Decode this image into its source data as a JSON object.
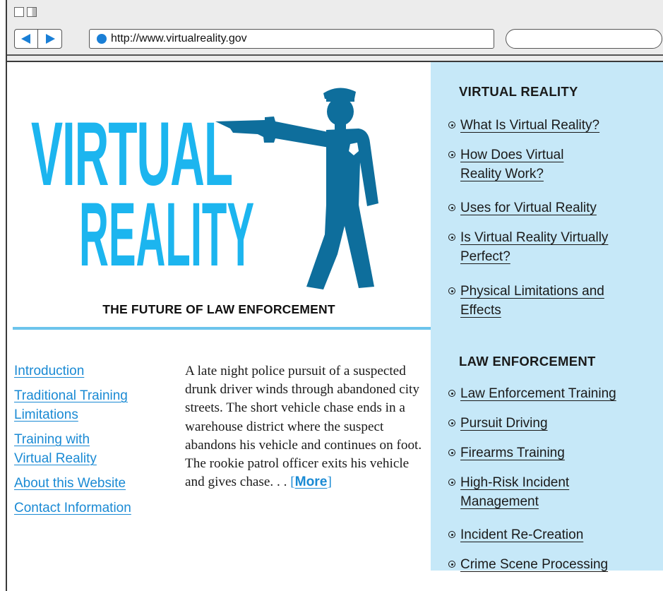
{
  "browser": {
    "url": "http://www.virtualreality.gov",
    "search_placeholder": ""
  },
  "hero": {
    "logo_line1": "VIRTUAL",
    "logo_line2": "REALITY",
    "tagline": "THE FUTURE OF LAW ENFORCEMENT"
  },
  "left_nav": [
    "Introduction",
    "Traditional Training Limitations",
    "Training with Virtual Reality",
    "About this Website",
    "Contact Information"
  ],
  "story": {
    "text": "A late night police pursuit of a suspected drunk driver winds through abandoned city streets. The short vehicle chase ends in a warehouse district where the suspect abandons his vehicle and continues on foot. The rookie patrol officer exits his vehicle and gives chase. . .",
    "more_label": "More",
    "bracket_open": "[",
    "bracket_close": "]"
  },
  "sidebar": {
    "vr_heading": "VIRTUAL REALITY",
    "vr_links": [
      "What Is Virtual Reality?",
      "How Does Virtual Reality Work?",
      "Uses for Virtual Reality",
      "Is Virtual Reality Virtually Perfect?",
      "Physical Limitations and Effects"
    ],
    "le_heading": "LAW ENFORCEMENT",
    "le_links": [
      "Law Enforcement Training",
      "Pursuit Driving",
      "Firearms Training",
      "High-Risk Incident Management",
      "Incident Re-Creation",
      "Crime Scene Processing"
    ]
  },
  "colors": {
    "link_blue": "#1a8ad4",
    "logo_cyan": "#1cb5ef",
    "officer_blue": "#0e6e9c",
    "sidebar_bg": "#c6e8f8",
    "rule": "#6cc4ec"
  },
  "icons": [
    "window-close-icon",
    "window-maximize-icon",
    "back-arrow-icon",
    "forward-arrow-icon",
    "globe-icon",
    "police-officer-icon",
    "bullet-icon"
  ]
}
